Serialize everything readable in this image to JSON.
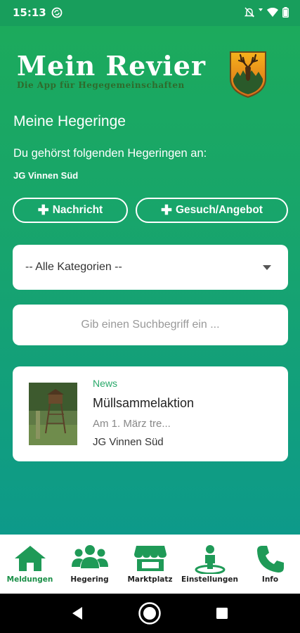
{
  "status_bar": {
    "time": "15:13"
  },
  "app": {
    "logo_title": "Mein Revier",
    "logo_subtitle": "Die App für Hegegemeinschaften"
  },
  "main": {
    "heading": "Meine Hegeringe",
    "subheading": "Du gehörst folgenden Hegeringen an:",
    "ring_name": "JG Vinnen Süd",
    "buttons": {
      "message_label": "Nachricht",
      "offer_label": "Gesuch/Angebot"
    },
    "category_select": {
      "selected": "-- Alle Kategorien --"
    },
    "search": {
      "placeholder": "Gib einen Suchbegriff ein ..."
    },
    "news": [
      {
        "category": "News",
        "title": "Müllsammelaktion",
        "excerpt": "Am 1. März tre...",
        "ring": "JG Vinnen Süd"
      }
    ]
  },
  "bottom_nav": {
    "items": [
      {
        "label": "Meldungen",
        "icon": "home-icon",
        "active": true
      },
      {
        "label": "Hegering",
        "icon": "group-icon",
        "active": false
      },
      {
        "label": "Marktplatz",
        "icon": "store-icon",
        "active": false
      },
      {
        "label": "Einstellungen",
        "icon": "person-pin-icon",
        "active": false
      },
      {
        "label": "Info",
        "icon": "phone-icon",
        "active": false
      }
    ]
  },
  "colors": {
    "primary": "#1aa35f",
    "accent_dark": "#1a8f47",
    "nav_icon": "#1f9a57"
  }
}
